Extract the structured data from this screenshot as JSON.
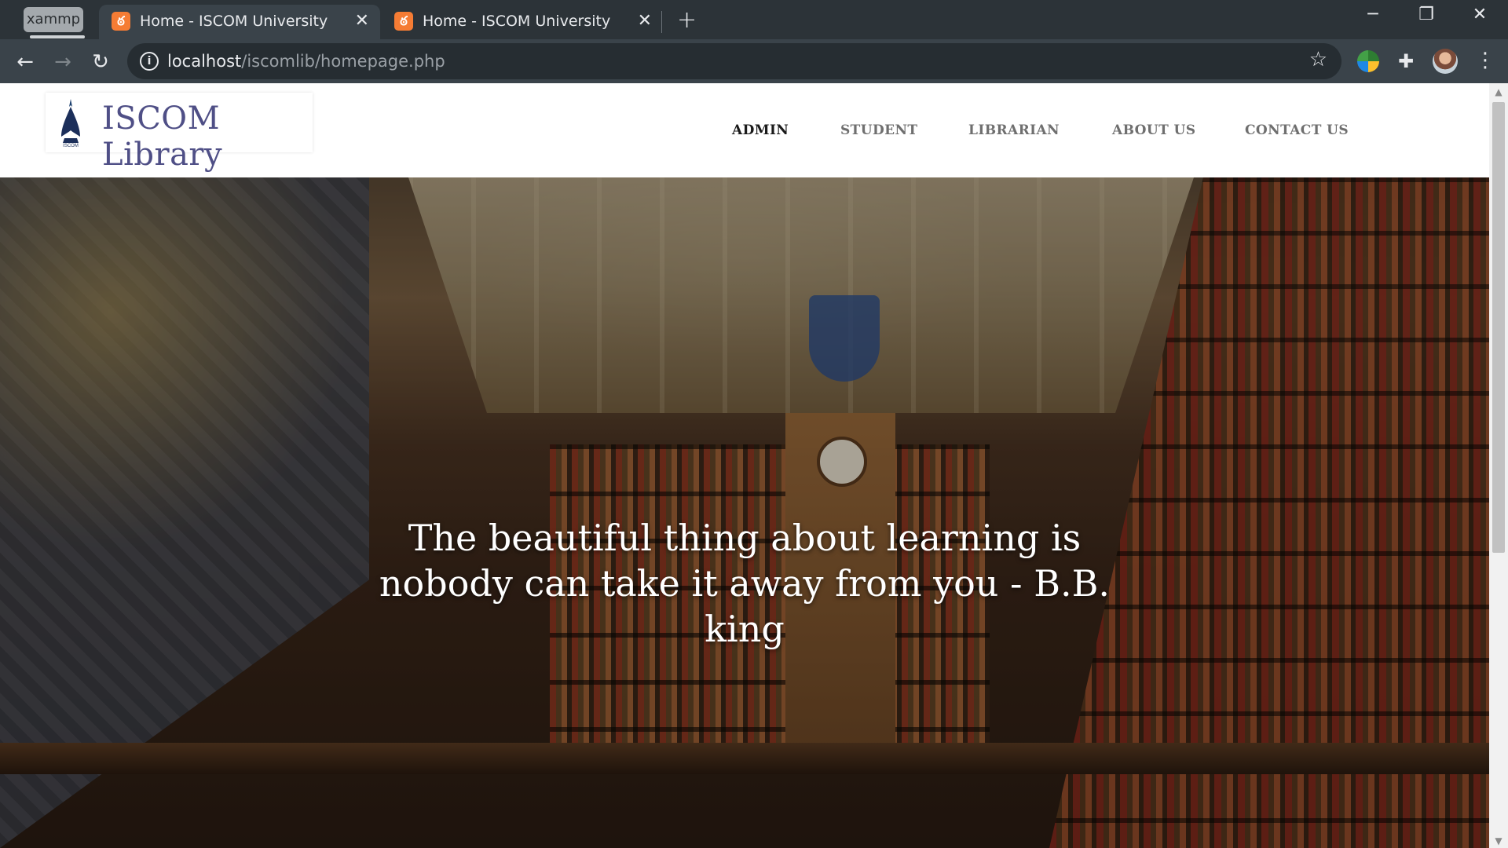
{
  "browser": {
    "profile_label": "xammp",
    "tabs": [
      {
        "title": "Home - ISCOM University",
        "favicon": "xampp-icon",
        "active": true
      },
      {
        "title": "Home - ISCOM University",
        "favicon": "xampp-icon",
        "active": false
      }
    ],
    "favicon_glyph": "ఠ",
    "url_host": "localhost",
    "url_path": "/iscomlib/homepage.php",
    "colors": {
      "chrome_bg": "#2c3338",
      "toolbar_bg": "#3a434a",
      "omnibox_bg": "#262d32",
      "favicon": "#f57c34"
    }
  },
  "site": {
    "logo_text": "ISCOM Library",
    "nav": [
      "ADMIN",
      "STUDENT",
      "LIBRARIAN",
      "ABOUT US",
      "CONTACT US"
    ],
    "active_nav": "ADMIN",
    "hero_quote": "The beautiful thing about learning is nobody can take it away from you - B.B. king",
    "colors": {
      "logo_text": "#4f4f86",
      "nav_text": "#6f6f6f",
      "nav_active": "#1a1a1a"
    }
  }
}
